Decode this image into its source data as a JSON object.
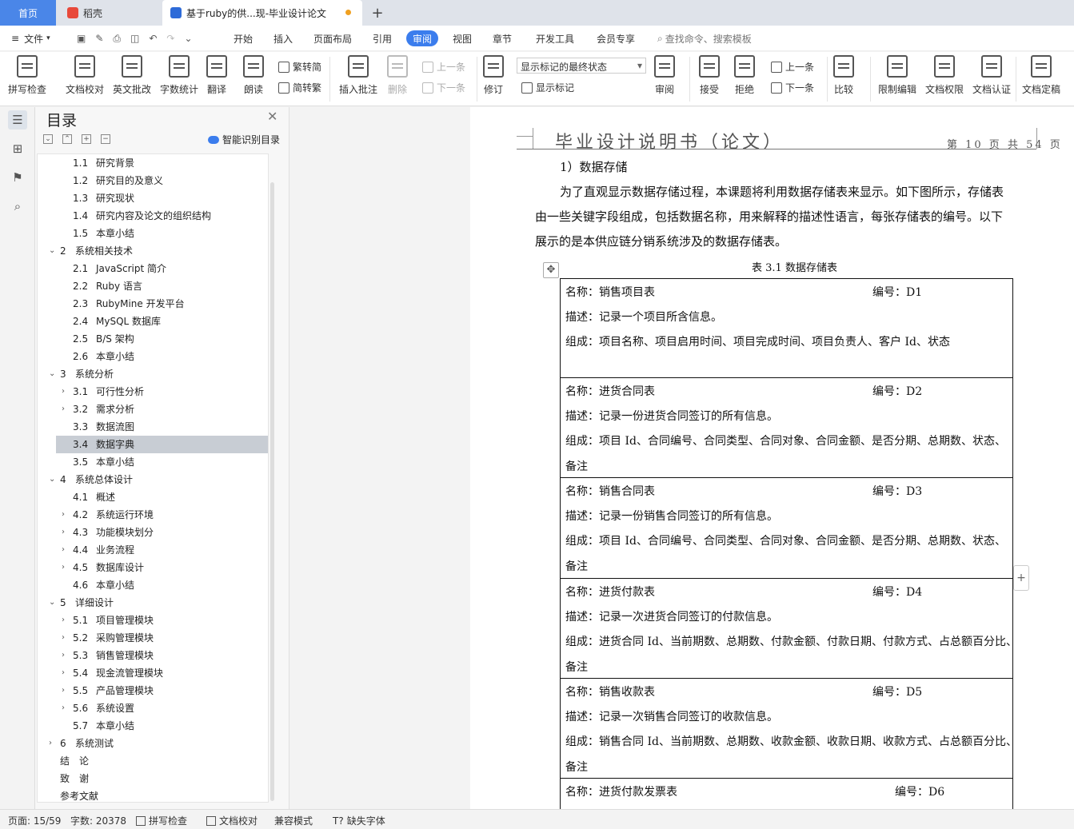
{
  "tabs": {
    "home": "首页",
    "daoke": "稻壳",
    "doc": "基于ruby的供...现-毕业设计论文",
    "add": "+"
  },
  "menu": {
    "file": "文件",
    "items": [
      "开始",
      "插入",
      "页面布局",
      "引用",
      "审阅",
      "视图",
      "章节",
      "开发工具",
      "会员专享"
    ],
    "search": "查找命令、搜索模板"
  },
  "ribbon": {
    "spell": "拼写检查",
    "proof": "文档校对",
    "en_review": "英文批改",
    "word_count": "字数统计",
    "translate": "翻译",
    "read": "朗读",
    "to_trad": "繁转简",
    "to_simp": "简转繁",
    "insert_comment": "插入批注",
    "delete": "删除",
    "prev_c": "上一条",
    "next_c": "下一条",
    "revise": "修订",
    "markup_state": "显示标记的最终状态",
    "show_markup": "显示标记",
    "review": "审阅",
    "accept": "接受",
    "reject": "拒绝",
    "prev": "上一条",
    "next": "下一条",
    "compare": "比较",
    "restrict": "限制编辑",
    "permission": "文档权限",
    "certify": "文档认证",
    "finalize": "文档定稿"
  },
  "nav": {
    "title": "目录",
    "smart": "智能识别目录"
  },
  "toc": [
    {
      "num": "1.1",
      "text": "研究背景",
      "lvl": 2
    },
    {
      "num": "1.2",
      "text": "研究目的及意义",
      "lvl": 2
    },
    {
      "num": "1.3",
      "text": "研究现状",
      "lvl": 2
    },
    {
      "num": "1.4",
      "text": "研究内容及论文的组织结构",
      "lvl": 2
    },
    {
      "num": "1.5",
      "text": "本章小结",
      "lvl": 2
    },
    {
      "num": "2",
      "text": "系统相关技术",
      "lvl": 1,
      "exp": "open"
    },
    {
      "num": "2.1",
      "text": "JavaScript 简介",
      "lvl": 2
    },
    {
      "num": "2.2",
      "text": "Ruby 语言",
      "lvl": 2
    },
    {
      "num": "2.3",
      "text": "RubyMine 开发平台",
      "lvl": 2
    },
    {
      "num": "2.4",
      "text": "MySQL 数据库",
      "lvl": 2
    },
    {
      "num": "2.5",
      "text": "B/S 架构",
      "lvl": 2
    },
    {
      "num": "2.6",
      "text": "本章小结",
      "lvl": 2
    },
    {
      "num": "3",
      "text": "系统分析",
      "lvl": 1,
      "exp": "open"
    },
    {
      "num": "3.1",
      "text": "可行性分析",
      "lvl": 2,
      "exp": "closed"
    },
    {
      "num": "3.2",
      "text": "需求分析",
      "lvl": 2,
      "exp": "closed"
    },
    {
      "num": "3.3",
      "text": "数据流图",
      "lvl": 2
    },
    {
      "num": "3.4",
      "text": "数据字典",
      "lvl": 2,
      "sel": true
    },
    {
      "num": "3.5",
      "text": "本章小结",
      "lvl": 2
    },
    {
      "num": "4",
      "text": "系统总体设计",
      "lvl": 1,
      "exp": "open"
    },
    {
      "num": "4.1",
      "text": "概述",
      "lvl": 2
    },
    {
      "num": "4.2",
      "text": "系统运行环境",
      "lvl": 2,
      "exp": "closed"
    },
    {
      "num": "4.3",
      "text": "功能模块划分",
      "lvl": 2,
      "exp": "closed"
    },
    {
      "num": "4.4",
      "text": "业务流程",
      "lvl": 2,
      "exp": "closed"
    },
    {
      "num": "4.5",
      "text": "数据库设计",
      "lvl": 2,
      "exp": "closed"
    },
    {
      "num": "4.6",
      "text": "本章小结",
      "lvl": 2
    },
    {
      "num": "5",
      "text": "详细设计",
      "lvl": 1,
      "exp": "open"
    },
    {
      "num": "5.1",
      "text": "项目管理模块",
      "lvl": 2,
      "exp": "closed"
    },
    {
      "num": "5.2",
      "text": "采购管理模块",
      "lvl": 2,
      "exp": "closed"
    },
    {
      "num": "5.3",
      "text": "销售管理模块",
      "lvl": 2,
      "exp": "closed"
    },
    {
      "num": "5.4",
      "text": "现金流管理模块",
      "lvl": 2,
      "exp": "closed"
    },
    {
      "num": "5.5",
      "text": "产品管理模块",
      "lvl": 2,
      "exp": "closed"
    },
    {
      "num": "5.6",
      "text": "系统设置",
      "lvl": 2,
      "exp": "closed"
    },
    {
      "num": "5.7",
      "text": "本章小结",
      "lvl": 2
    },
    {
      "num": "6",
      "text": "系统测试",
      "lvl": 1,
      "exp": "closed"
    },
    {
      "num": "",
      "text": "结　论",
      "lvl": 0
    },
    {
      "num": "",
      "text": "致　谢",
      "lvl": 0
    },
    {
      "num": "",
      "text": "参考文献",
      "lvl": 0
    }
  ],
  "doc": {
    "header_title": "毕业设计说明书（论文）",
    "header_page": "第 10 页 共 54 页",
    "heading": "1）数据存储",
    "para": [
      "为了直观显示数据存储过程，本课题将利用数据存储表来显示。如下图所示，存储表",
      "由一些关键字段组成，包括数据名称，用来解释的描述性语言，每张存储表的编号。以下",
      "展示的是本供应链分销系统涉及的数据存储表。"
    ],
    "table_caption": "表 3.1  数据存储表",
    "rows": [
      {
        "name": "名称：销售项目表",
        "code": "编号：D1",
        "desc": "描述：记录一个项目所含信息。",
        "comp": [
          "组成：项目名称、项目启用时间、项目完成时间、项目负责人、客户 Id、状态",
          ""
        ]
      },
      {
        "name": "名称：进货合同表",
        "code": "编号：D2",
        "desc": "描述：记录一份进货合同签订的所有信息。",
        "comp": [
          "组成：项目 Id、合同编号、合同类型、合同对象、合同金额、是否分期、总期数、状态、",
          "备注"
        ]
      },
      {
        "name": "名称：销售合同表",
        "code": "编号：D3",
        "desc": "描述：记录一份销售合同签订的所有信息。",
        "comp": [
          "组成：项目 Id、合同编号、合同类型、合同对象、合同金额、是否分期、总期数、状态、",
          "备注"
        ]
      },
      {
        "name": "名称：进货付款表",
        "code": "编号：D4",
        "desc": "描述：记录一次进货合同签订的付款信息。",
        "comp": [
          "组成：进货合同 Id、当前期数、总期数、付款金额、付款日期、付款方式、占总额百分比、",
          "备注"
        ]
      },
      {
        "name": "名称：销售收款表",
        "code": "编号：D5",
        "desc": "描述：记录一次销售合同签订的收款信息。",
        "comp": [
          "组成：销售合同 Id、当前期数、总期数、收款金额、收款日期、收款方式、占总额百分比、",
          "备注"
        ]
      },
      {
        "name": "名称：进货付款发票表",
        "code": "编号：D6",
        "desc": "",
        "comp": [
          "",
          ""
        ]
      }
    ]
  },
  "status": {
    "page": "页面: 15/59",
    "words": "字数: 20378",
    "spell": "拼写检查",
    "proof": "文档校对",
    "compat": "兼容模式",
    "missing_font": "缺失字体"
  }
}
